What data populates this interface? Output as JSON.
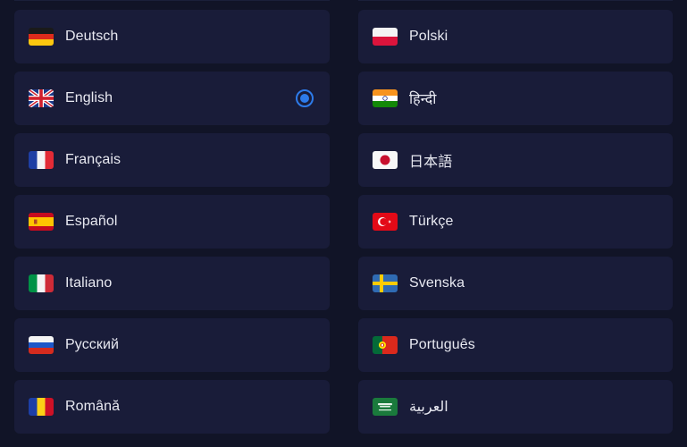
{
  "accent_color": "#2d7bea",
  "selected": "English",
  "languages": [
    {
      "label": "Deutsch",
      "flag": "germany-flag-icon"
    },
    {
      "label": "Polski",
      "flag": "poland-flag-icon"
    },
    {
      "label": "English",
      "flag": "uk-flag-icon"
    },
    {
      "label": "हिन्दी",
      "flag": "india-flag-icon"
    },
    {
      "label": "Français",
      "flag": "france-flag-icon"
    },
    {
      "label": "日本語",
      "flag": "japan-flag-icon"
    },
    {
      "label": "Español",
      "flag": "spain-flag-icon"
    },
    {
      "label": "Türkçe",
      "flag": "turkey-flag-icon"
    },
    {
      "label": "Italiano",
      "flag": "italy-flag-icon"
    },
    {
      "label": "Svenska",
      "flag": "sweden-flag-icon"
    },
    {
      "label": "Русский",
      "flag": "russia-flag-icon"
    },
    {
      "label": "Português",
      "flag": "portugal-flag-icon"
    },
    {
      "label": "Română",
      "flag": "romania-flag-icon"
    },
    {
      "label": "العربية",
      "flag": "saudi-arabia-flag-icon"
    }
  ]
}
